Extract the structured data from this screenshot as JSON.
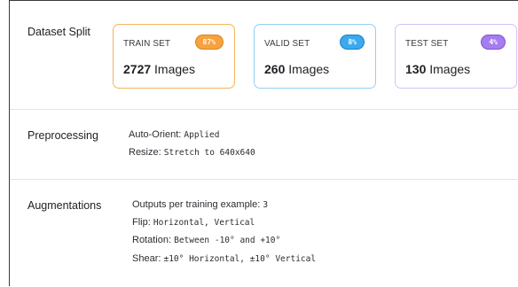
{
  "dataset_split": {
    "title": "Dataset Split",
    "cards": [
      {
        "label": "TRAIN SET",
        "badge": "87%",
        "count": "2727",
        "unit": "Images",
        "color": "#f4a340"
      },
      {
        "label": "VALID SET",
        "badge": "8%",
        "count": "260",
        "unit": "Images",
        "color": "#3aa9ee"
      },
      {
        "label": "TEST SET",
        "badge": "4%",
        "count": "130",
        "unit": "Images",
        "color": "#a67cf0"
      }
    ]
  },
  "preprocessing": {
    "title": "Preprocessing",
    "items": [
      {
        "key": "Auto-Orient:",
        "value": "Applied"
      },
      {
        "key": "Resize:",
        "value": "Stretch to 640x640"
      }
    ]
  },
  "augmentations": {
    "title": "Augmentations",
    "items": [
      {
        "key": "Outputs per training example:",
        "value": "3"
      },
      {
        "key": "Flip:",
        "value": "Horizontal, Vertical"
      },
      {
        "key": "Rotation:",
        "value": "Between -10° and +10°"
      },
      {
        "key": "Shear:",
        "value": "±10° Horizontal, ±10° Vertical"
      }
    ]
  }
}
